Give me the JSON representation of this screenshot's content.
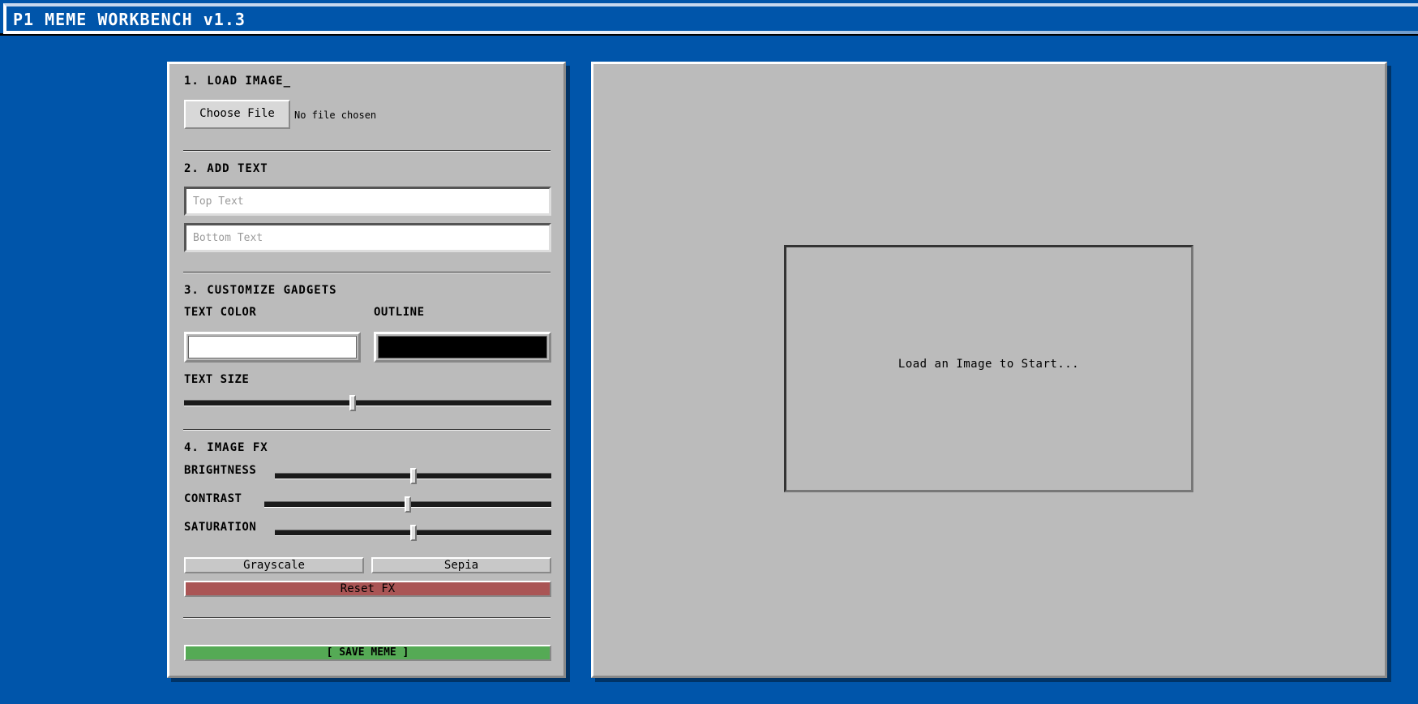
{
  "window": {
    "title": "P1 MEME WORKBENCH v1.3"
  },
  "sections": {
    "load_image": {
      "title": "1. LOAD IMAGE_",
      "file_button_label": "Choose File",
      "file_status": "No file chosen"
    },
    "add_text": {
      "title": "2. ADD TEXT",
      "top_text": {
        "value": "",
        "placeholder": "Top Text"
      },
      "bottom_text": {
        "value": "",
        "placeholder": "Bottom Text"
      }
    },
    "customize": {
      "title": "3. CUSTOMIZE GADGETS",
      "text_color_label": "TEXT COLOR",
      "text_color": "#ffffff",
      "outline_label": "OUTLINE",
      "outline_color": "#000000",
      "text_size_label": "TEXT SIZE",
      "text_size_fraction": 0.46
    },
    "image_fx": {
      "title": "4. IMAGE FX",
      "brightness_label": "BRIGHTNESS",
      "brightness_fraction": 0.5,
      "contrast_label": "CONTRAST",
      "contrast_fraction": 0.5,
      "saturation_label": "SATURATION",
      "saturation_fraction": 0.5,
      "grayscale_label": "Grayscale",
      "sepia_label": "Sepia",
      "reset_label": "Reset FX"
    },
    "save": {
      "label": "[ SAVE MEME ]"
    }
  },
  "preview": {
    "placeholder_message": "Load an Image to Start..."
  },
  "colors": {
    "desktop": "#0055aa",
    "panel": "#bbbbbb",
    "reset_button": "#aa5555",
    "save_button": "#55aa55"
  }
}
